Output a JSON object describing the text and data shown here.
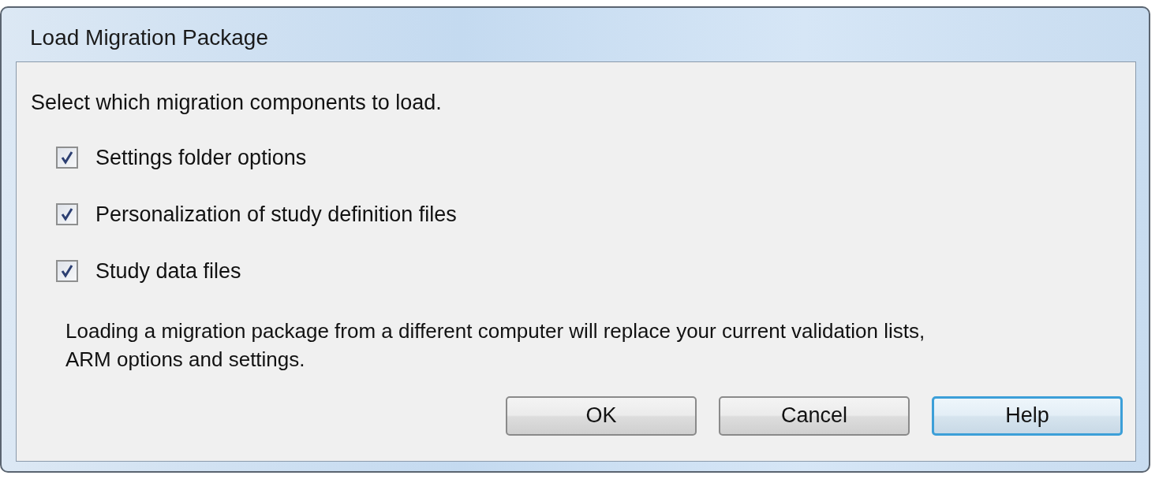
{
  "window": {
    "title": "Load Migration Package"
  },
  "instruction": "Select which migration components to load.",
  "options": [
    {
      "label": "Settings folder options",
      "checked": true
    },
    {
      "label": "Personalization of study definition files",
      "checked": true
    },
    {
      "label": "Study data files",
      "checked": true
    }
  ],
  "note": "Loading a migration package from a different computer will replace your current validation lists, ARM options and settings.",
  "buttons": [
    {
      "label": "OK",
      "focused": false
    },
    {
      "label": "Cancel",
      "focused": false
    },
    {
      "label": "Help",
      "focused": true
    }
  ]
}
